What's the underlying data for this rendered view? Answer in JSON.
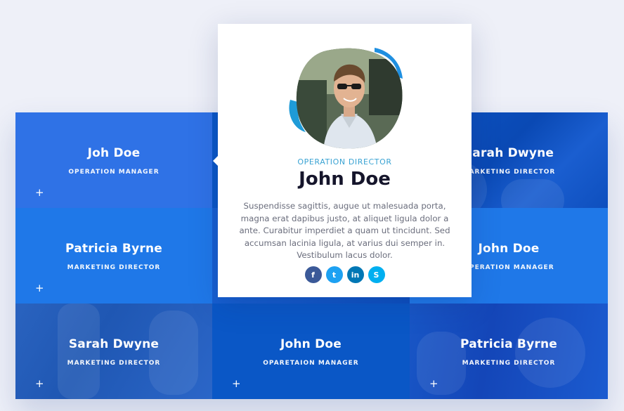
{
  "members": [
    {
      "name": "Joh Doe",
      "role": "OPERATION MANAGER"
    },
    {
      "name": "Sarah Dwyne",
      "role": "MARKETING DIRECTOR"
    },
    {
      "name": "Patricia Byrne",
      "role": "MARKETING DIRECTOR"
    },
    {
      "name": "John Doe",
      "role": "OPERATION MANAGER"
    },
    {
      "name": "Sarah Dwyne",
      "role": "MARKETING DIRECTOR"
    },
    {
      "name": "John Doe",
      "role": "OPARETAION MANAGER"
    },
    {
      "name": "Patricia Byrne",
      "role": "MARKETING DIRECTOR"
    }
  ],
  "plus_symbol": "+",
  "featured": {
    "role": "OPERATION DIRECTOR",
    "name": "John Doe",
    "description": "Suspendisse sagittis, augue ut malesuada porta, magna erat dapibus justo, at aliquet ligula dolor a ante. Curabitur imperdiet a quam ut tincidunt. Sed accumsan lacinia ligula, at varius dui semper in. Vestibulum lacus dolor.",
    "socials": [
      {
        "icon": "facebook-icon",
        "glyph": "f",
        "color": "#3b5998"
      },
      {
        "icon": "twitter-icon",
        "glyph": "t",
        "color": "#1da1f2"
      },
      {
        "icon": "linkedin-icon",
        "glyph": "in",
        "color": "#0077b5"
      },
      {
        "icon": "skype-icon",
        "glyph": "S",
        "color": "#00aff0"
      }
    ]
  },
  "colors": {
    "accent_blue": "#1f78e8",
    "role_label": "#3aa3d3",
    "title_text": "#15152b"
  }
}
